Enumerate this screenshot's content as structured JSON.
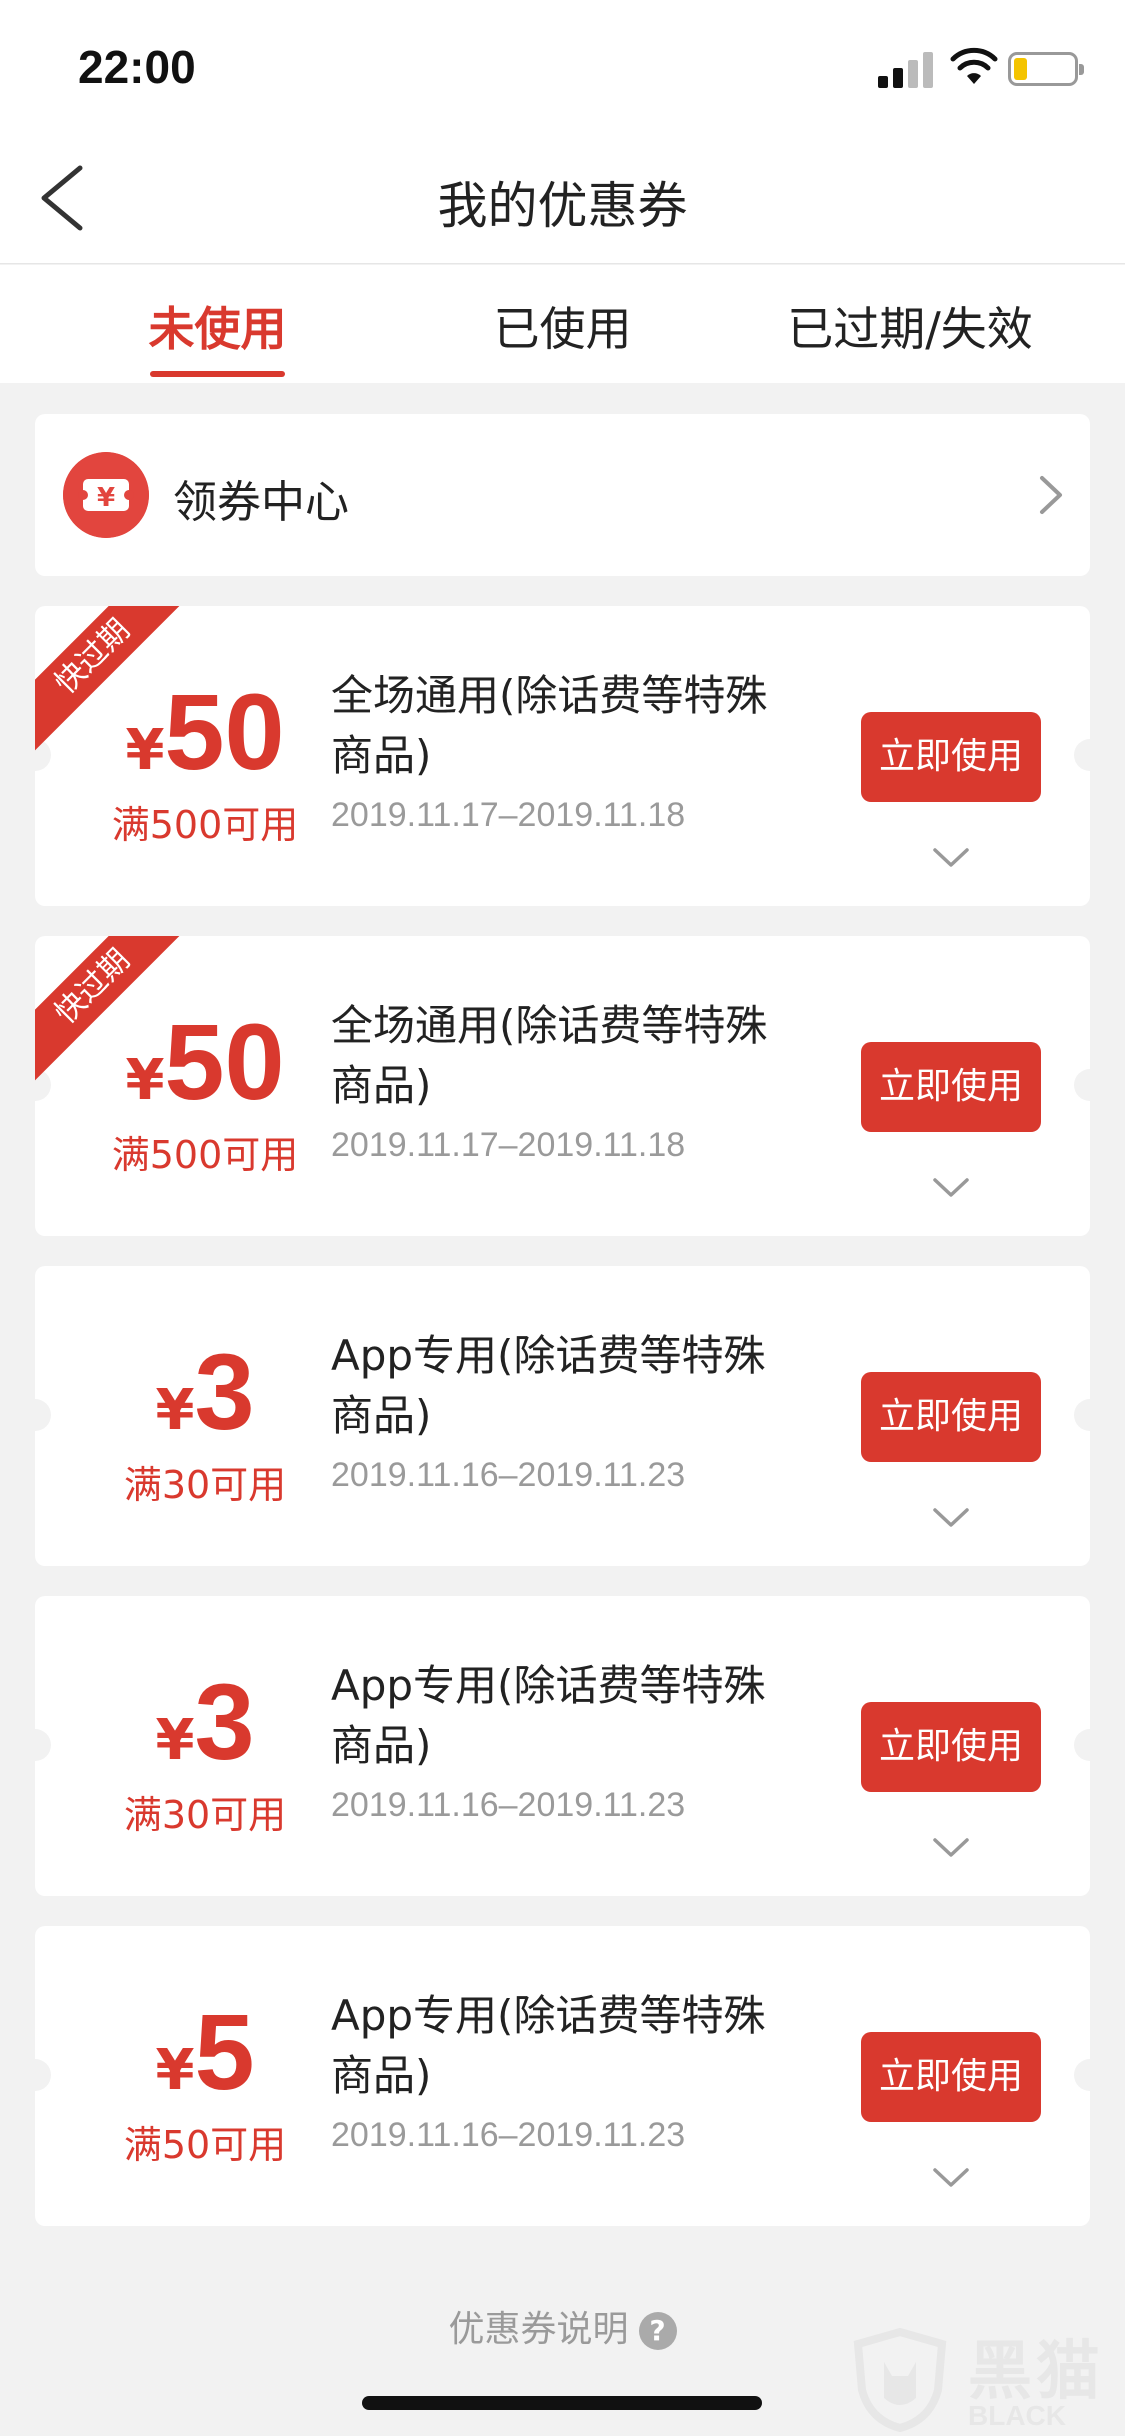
{
  "status_bar": {
    "time": "22:00"
  },
  "nav": {
    "title": "我的优惠券"
  },
  "tabs": [
    {
      "label": "未使用",
      "active": true
    },
    {
      "label": "已使用",
      "active": false
    },
    {
      "label": "已过期/失效",
      "active": false
    }
  ],
  "coupon_center": {
    "label": "领券中心",
    "icon_glyph": "¥"
  },
  "coupons": [
    {
      "ribbon": "快过期",
      "currency": "¥",
      "amount": "50",
      "condition": "满500可用",
      "description": "全场通用(除话费等特殊商品)",
      "date_range": "2019.11.17–2019.11.18",
      "button": "立即使用"
    },
    {
      "ribbon": "快过期",
      "currency": "¥",
      "amount": "50",
      "condition": "满500可用",
      "description": "全场通用(除话费等特殊商品)",
      "date_range": "2019.11.17–2019.11.18",
      "button": "立即使用"
    },
    {
      "currency": "¥",
      "amount": "3",
      "condition": "满30可用",
      "description": "App专用(除话费等特殊商品)",
      "date_range": "2019.11.16–2019.11.23",
      "button": "立即使用"
    },
    {
      "currency": "¥",
      "amount": "3",
      "condition": "满30可用",
      "description": "App专用(除话费等特殊商品)",
      "date_range": "2019.11.16–2019.11.23",
      "button": "立即使用"
    },
    {
      "currency": "¥",
      "amount": "5",
      "condition": "满50可用",
      "description": "App专用(除话费等特殊商品)",
      "date_range": "2019.11.16–2019.11.23",
      "button": "立即使用"
    }
  ],
  "footer": {
    "link": "优惠券说明",
    "help_glyph": "?"
  },
  "watermark": {
    "cn": "黑猫",
    "en": "BLACK CAT"
  },
  "colors": {
    "accent": "#d9392e",
    "background": "#f2f2f2",
    "muted_text": "#9a9a9a"
  }
}
